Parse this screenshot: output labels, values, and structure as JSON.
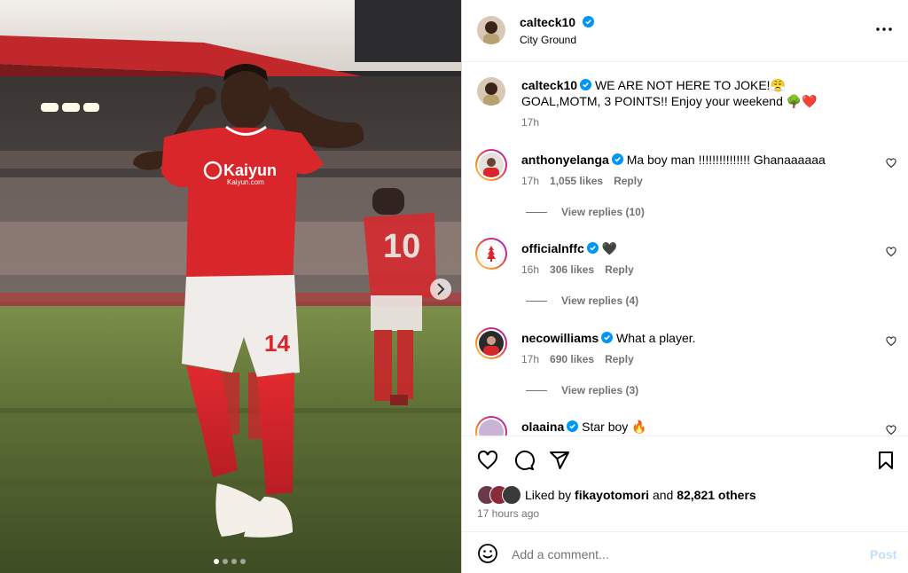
{
  "post": {
    "username": "calteck10",
    "location": "City Ground",
    "caption_user": "calteck10",
    "caption_text": "WE ARE NOT HERE TO JOKE!😤 GOAL,MOTM, 3 POINTS!! Enjoy your weekend 🌳❤️",
    "caption_time": "17h",
    "more_icon": "more-horizontal-icon"
  },
  "media": {
    "jersey_sponsor": "Kaiyun",
    "jersey_sponsor_url": "Kaiyun.com",
    "shirt_number": "14",
    "back_number": "10",
    "carousel_index": 1,
    "carousel_count": 4
  },
  "comments": [
    {
      "user": "anthonyelanga",
      "text": "Ma boy man !!!!!!!!!!!!!!! Ghanaaaaaa",
      "time": "17h",
      "likes": "1,055 likes",
      "reply": "Reply",
      "view_replies": "View replies (10)"
    },
    {
      "user": "officialnffc",
      "text": "🖤",
      "time": "16h",
      "likes": "306 likes",
      "reply": "Reply",
      "view_replies": "View replies (4)"
    },
    {
      "user": "necowilliams",
      "text": "What a player.",
      "time": "17h",
      "likes": "690 likes",
      "reply": "Reply",
      "view_replies": "View replies (3)"
    },
    {
      "user": "olaaina",
      "text": "Star boy 🔥"
    }
  ],
  "likes": {
    "prefix": "Liked by",
    "user": "fikayotomori",
    "and": "and",
    "others": "82,821 others",
    "time": "17 hours ago"
  },
  "add_comment": {
    "placeholder": "Add a comment...",
    "post_label": "Post"
  },
  "colors": {
    "verified": "#0095f6",
    "muted": "#737373",
    "post_disabled": "#c0dffd",
    "jersey_red": "#d9262b"
  }
}
